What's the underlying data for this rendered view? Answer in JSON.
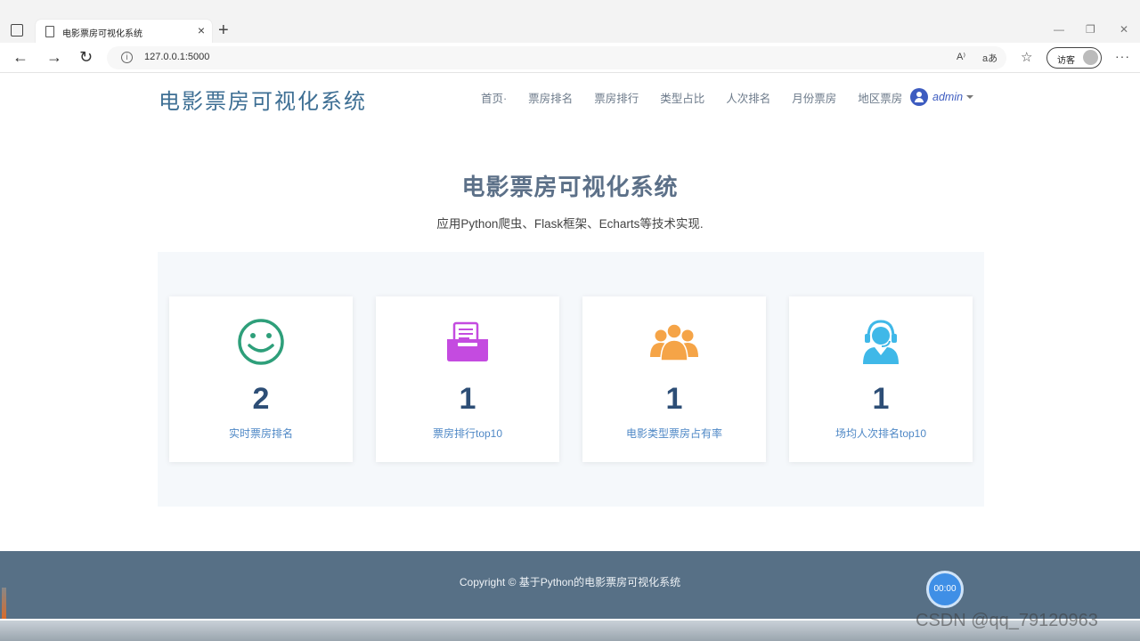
{
  "browser": {
    "tab_title": "电影票房可视化系统",
    "url": "127.0.0.1:5000",
    "read_aloud": "A⁾",
    "translate": "aあ",
    "guest_label": "访客"
  },
  "site": {
    "brand": "电影票房可视化系统",
    "menu": [
      "首页·",
      "票房排名",
      "票房排行",
      "类型占比",
      "人次排名",
      "月份票房",
      "地区票房"
    ],
    "user": "admin"
  },
  "hero": {
    "title": "电影票房可视化系统",
    "subtitle": "应用Python爬虫、Flask框架、Echarts等技术实现."
  },
  "cards": [
    {
      "value": "2",
      "label": "实时票房排名",
      "icon": "smiley-icon",
      "color": "#2e9f7a"
    },
    {
      "value": "1",
      "label": "票房排行top10",
      "icon": "printer-tray-icon",
      "color": "#c44be0"
    },
    {
      "value": "1",
      "label": "电影类型票房占有率",
      "icon": "people-group-icon",
      "color": "#f5a447"
    },
    {
      "value": "1",
      "label": "场均人次排名top10",
      "icon": "headset-person-icon",
      "color": "#3fb8e8"
    }
  ],
  "footer": {
    "copyright": "Copyright © 基于Python的电影票房可视化系统"
  },
  "overlay": {
    "timer": "00:00",
    "watermark": "CSDN @qq_79120963"
  }
}
